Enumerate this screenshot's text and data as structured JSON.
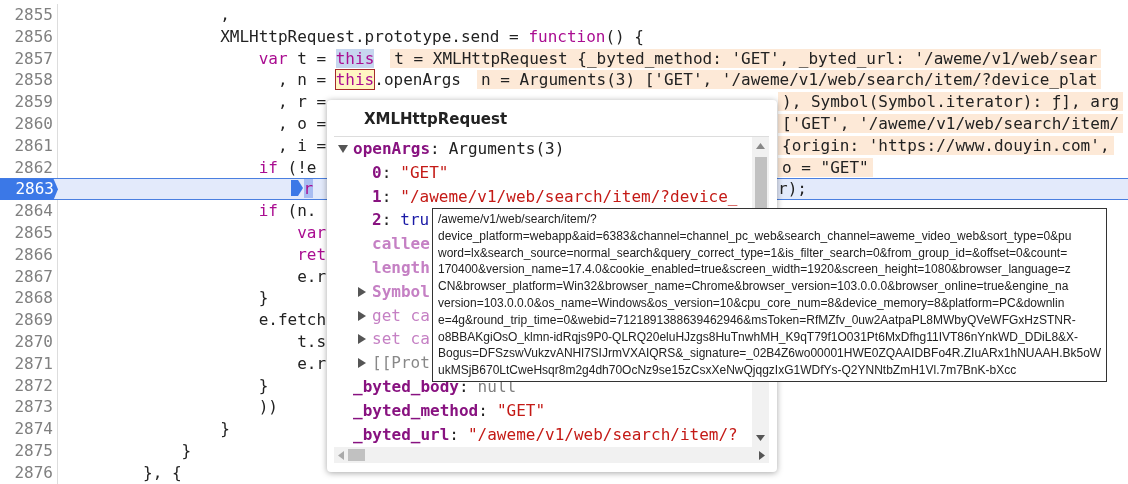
{
  "editor": {
    "lines": [
      {
        "number": "2855",
        "current": false,
        "code": [
          {
            "text": "                ,",
            "kind": "plain"
          }
        ]
      },
      {
        "number": "2856",
        "current": false,
        "code": [
          {
            "text": "                XMLHttpRequest.prototype.send = ",
            "kind": "plain"
          },
          {
            "text": "function",
            "kind": "keyword"
          },
          {
            "text": "() {",
            "kind": "plain"
          }
        ]
      },
      {
        "number": "2857",
        "current": false,
        "code": [
          {
            "text": "                    var",
            "kind": "keyword"
          },
          {
            "text": " t = ",
            "kind": "plain"
          },
          {
            "text": "this",
            "kind": "selected-word"
          },
          {
            "text": "t = XMLHttpRequest {_byted_method: 'GET', _byted_url: '/aweme/v1/web/sear",
            "kind": "inline-value"
          }
        ]
      },
      {
        "number": "2858",
        "current": false,
        "code": [
          {
            "text": "                      , n = ",
            "kind": "plain"
          },
          {
            "text": "this",
            "kind": "hovered-word"
          },
          {
            "text": ".openArgs",
            "kind": "plain"
          },
          {
            "text": "n = Arguments(3) ['GET', '/aweme/v1/web/search/item/?device_plat",
            "kind": "inline-value"
          }
        ]
      },
      {
        "number": "2859",
        "current": false,
        "code": [
          {
            "text": "                      , r =",
            "kind": "plain"
          }
        ],
        "tail": [
          {
            "text": "), Symbol(Symbol.iterator): ƒ], arg",
            "kind": "inline-value"
          }
        ]
      },
      {
        "number": "2860",
        "current": false,
        "code": [
          {
            "text": "                      , o =",
            "kind": "plain"
          }
        ],
        "tail": [
          {
            "text": "['GET', '/aweme/v1/web/search/item/",
            "kind": "inline-value"
          }
        ]
      },
      {
        "number": "2861",
        "current": false,
        "code": [
          {
            "text": "                      , i =",
            "kind": "plain"
          }
        ],
        "tail": [
          {
            "text": "{origin: 'https://www.douyin.com',",
            "kind": "inline-value"
          }
        ]
      },
      {
        "number": "2862",
        "current": false,
        "code": [
          {
            "text": "                    if",
            "kind": "keyword"
          },
          {
            "text": " (!e",
            "kind": "plain"
          }
        ],
        "tail": [
          {
            "text": "o = \"GET\"",
            "kind": "inline-value"
          }
        ]
      },
      {
        "number": "2863",
        "current": true,
        "code": [
          {
            "text": "                       r",
            "kind": "paused-expression"
          }
        ],
        "tail": [
          {
            "text": "r);",
            "kind": "plain"
          }
        ]
      },
      {
        "number": "2864",
        "current": false,
        "code": [
          {
            "text": "                    if",
            "kind": "keyword"
          },
          {
            "text": " (n.",
            "kind": "plain"
          }
        ]
      },
      {
        "number": "2865",
        "current": false,
        "code": [
          {
            "text": "                        var",
            "kind": "keyword"
          }
        ]
      },
      {
        "number": "2866",
        "current": false,
        "code": [
          {
            "text": "                        ret",
            "kind": "keyword"
          }
        ]
      },
      {
        "number": "2867",
        "current": false,
        "code": [
          {
            "text": "                        e.r",
            "kind": "plain"
          }
        ]
      },
      {
        "number": "2868",
        "current": false,
        "code": [
          {
            "text": "                    }",
            "kind": "plain"
          }
        ]
      },
      {
        "number": "2869",
        "current": false,
        "code": [
          {
            "text": "                    e.fetch",
            "kind": "plain"
          }
        ]
      },
      {
        "number": "2870",
        "current": false,
        "code": [
          {
            "text": "                        t.s",
            "kind": "plain"
          }
        ]
      },
      {
        "number": "2871",
        "current": false,
        "code": [
          {
            "text": "                        e.r",
            "kind": "plain"
          }
        ]
      },
      {
        "number": "2872",
        "current": false,
        "code": [
          {
            "text": "                    }",
            "kind": "plain"
          }
        ]
      },
      {
        "number": "2873",
        "current": false,
        "code": [
          {
            "text": "                    ))",
            "kind": "plain"
          }
        ]
      },
      {
        "number": "2874",
        "current": false,
        "code": [
          {
            "text": "                }",
            "kind": "plain"
          }
        ]
      },
      {
        "number": "2875",
        "current": false,
        "code": [
          {
            "text": "            }",
            "kind": "plain"
          }
        ]
      },
      {
        "number": "2876",
        "current": false,
        "code": [
          {
            "text": "        }, {",
            "kind": "plain"
          }
        ]
      }
    ]
  },
  "popover": {
    "title": "XMLHttpRequest",
    "properties": [
      {
        "name": "openArgs",
        "kind": "own",
        "separator": ":",
        "value": {
          "text": "Arguments(3)",
          "kind": "object"
        },
        "expanded": true,
        "children": [
          {
            "name": "0",
            "kind": "own",
            "separator": ":",
            "value": {
              "text": "\"GET\"",
              "kind": "string"
            }
          },
          {
            "name": "1",
            "kind": "own",
            "separator": ":",
            "value": {
              "text": "\"/aweme/v1/web/search/item/?device_",
              "kind": "string"
            }
          },
          {
            "name": "2",
            "kind": "own",
            "separator": ":",
            "value": {
              "text": "tru",
              "kind": "boolean"
            }
          },
          {
            "name": "callee",
            "kind": "hidden"
          },
          {
            "name": "length",
            "kind": "hidden"
          },
          {
            "name": "Symbol",
            "kind": "hidden",
            "expanded": false
          },
          {
            "name": "get ca",
            "kind": "accessor",
            "expanded": false
          },
          {
            "name": "set ca",
            "kind": "accessor",
            "expanded": false
          },
          {
            "name": "[[Prot",
            "kind": "internal",
            "expanded": false
          }
        ]
      },
      {
        "name": "_byted_body",
        "kind": "own",
        "separator": ":",
        "value": {
          "text": "null",
          "kind": "null"
        }
      },
      {
        "name": "_byted_method",
        "kind": "own",
        "separator": ":",
        "value": {
          "text": "\"GET\"",
          "kind": "string"
        }
      },
      {
        "name": "_byted_url",
        "kind": "own",
        "separator": ":",
        "value": {
          "text": "\"/aweme/v1/web/search/item/?",
          "kind": "string"
        }
      }
    ]
  },
  "tooltip": {
    "lines": [
      "/aweme/v1/web/search/item/?",
      "device_platform=webapp&aid=6383&channel=channel_pc_web&search_channel=aweme_video_web&sort_type=0&pu",
      "word=lx&search_source=normal_search&query_correct_type=1&is_filter_search=0&from_group_id=&offset=0&count=",
      "170400&version_name=17.4.0&cookie_enabled=true&screen_width=1920&screen_height=1080&browser_language=z",
      "CN&browser_platform=Win32&browser_name=Chrome&browser_version=103.0.0.0&browser_online=true&engine_na",
      "version=103.0.0.0&os_name=Windows&os_version=10&cpu_core_num=8&device_memory=8&platform=PC&downlin",
      "e=4g&round_trip_time=0&webid=7121891388639462946&msToken=RfMZfv_0uw2AatpaPL8MWbyQVeWFGxHzSTNR-",
      "o8BBAKgiOsO_klmn-idRqjs9P0-QLRQ20eluHJzgs8HuTnwhMH_K9qT79f1O031Pt6MxDfhg11IVT86nYnkWD_DDiL8&X-",
      "Bogus=DFSzswVukzvANHl7SIJrmVXAIQRS&_signature=_02B4Z6wo00001HWE0ZQAAIDBFo4R.ZIuARx1hNUAAH.Bk5oW",
      "ukMSjB670LtCweHsqr8m2g4dh70OcNz9se15zCsxXeNwQjqgzIxG1WDfYs-Q2YNNtbZmH1Vl.7m7BnK-bXcc"
    ]
  }
}
